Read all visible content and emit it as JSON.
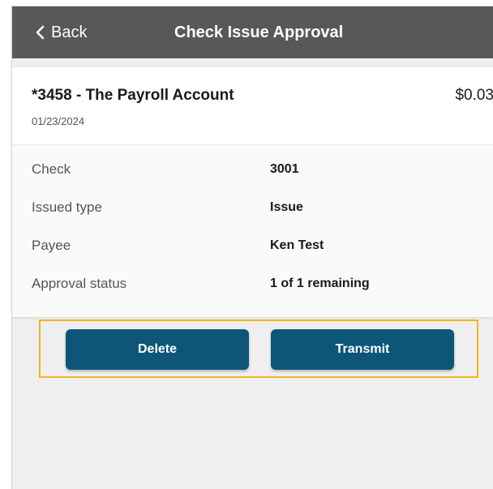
{
  "header": {
    "back_label": "Back",
    "title": "Check Issue Approval",
    "background_color": "#575859"
  },
  "account": {
    "name": "*3458 - The Payroll Account",
    "amount": "$0.03",
    "date": "01/23/2024"
  },
  "details": [
    {
      "label": "Check",
      "value": "3001"
    },
    {
      "label": "Issued type",
      "value": "Issue"
    },
    {
      "label": "Payee",
      "value": "Ken Test"
    },
    {
      "label": "Approval status",
      "value": "1 of 1 remaining"
    }
  ],
  "actions": {
    "delete_label": "Delete",
    "transmit_label": "Transmit",
    "button_color": "#0d5678",
    "highlight_color": "#f2b51c"
  },
  "icons": {
    "back": "chevron-left-icon"
  }
}
